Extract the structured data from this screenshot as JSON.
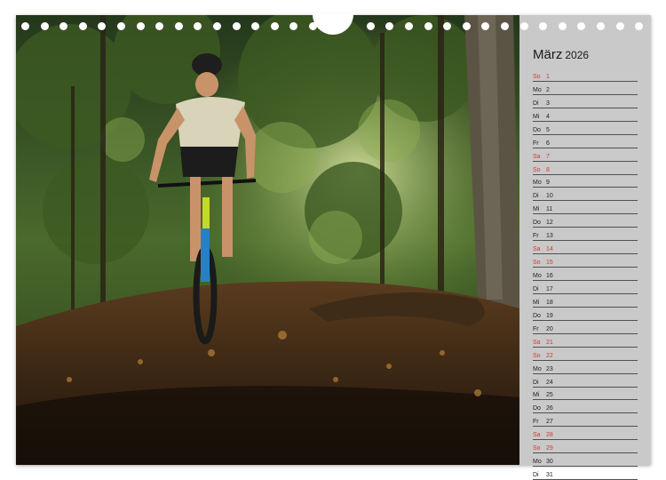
{
  "calendar": {
    "month": "März",
    "year": "2026",
    "colors": {
      "weekend": "#d23a2a",
      "text": "#222222",
      "sidebar": "#c9c9c9"
    },
    "days": [
      {
        "wd": "So",
        "d": "1",
        "we": true
      },
      {
        "wd": "Mo",
        "d": "2",
        "we": false
      },
      {
        "wd": "Di",
        "d": "3",
        "we": false
      },
      {
        "wd": "Mi",
        "d": "4",
        "we": false
      },
      {
        "wd": "Do",
        "d": "5",
        "we": false
      },
      {
        "wd": "Fr",
        "d": "6",
        "we": false
      },
      {
        "wd": "Sa",
        "d": "7",
        "we": true
      },
      {
        "wd": "So",
        "d": "8",
        "we": true
      },
      {
        "wd": "Mo",
        "d": "9",
        "we": false
      },
      {
        "wd": "Di",
        "d": "10",
        "we": false
      },
      {
        "wd": "Mi",
        "d": "11",
        "we": false
      },
      {
        "wd": "Do",
        "d": "12",
        "we": false
      },
      {
        "wd": "Fr",
        "d": "13",
        "we": false
      },
      {
        "wd": "Sa",
        "d": "14",
        "we": true
      },
      {
        "wd": "So",
        "d": "15",
        "we": true
      },
      {
        "wd": "Mo",
        "d": "16",
        "we": false
      },
      {
        "wd": "Di",
        "d": "17",
        "we": false
      },
      {
        "wd": "Mi",
        "d": "18",
        "we": false
      },
      {
        "wd": "Do",
        "d": "19",
        "we": false
      },
      {
        "wd": "Fr",
        "d": "20",
        "we": false
      },
      {
        "wd": "Sa",
        "d": "21",
        "we": true
      },
      {
        "wd": "So",
        "d": "22",
        "we": true
      },
      {
        "wd": "Mo",
        "d": "23",
        "we": false
      },
      {
        "wd": "Di",
        "d": "24",
        "we": false
      },
      {
        "wd": "Mi",
        "d": "25",
        "we": false
      },
      {
        "wd": "Do",
        "d": "26",
        "we": false
      },
      {
        "wd": "Fr",
        "d": "27",
        "we": false
      },
      {
        "wd": "Sa",
        "d": "28",
        "we": true
      },
      {
        "wd": "So",
        "d": "29",
        "we": true
      },
      {
        "wd": "Mo",
        "d": "30",
        "we": false
      },
      {
        "wd": "Di",
        "d": "31",
        "we": false
      }
    ]
  },
  "photo": {
    "icon": "mountain-biker-forest-photo"
  }
}
